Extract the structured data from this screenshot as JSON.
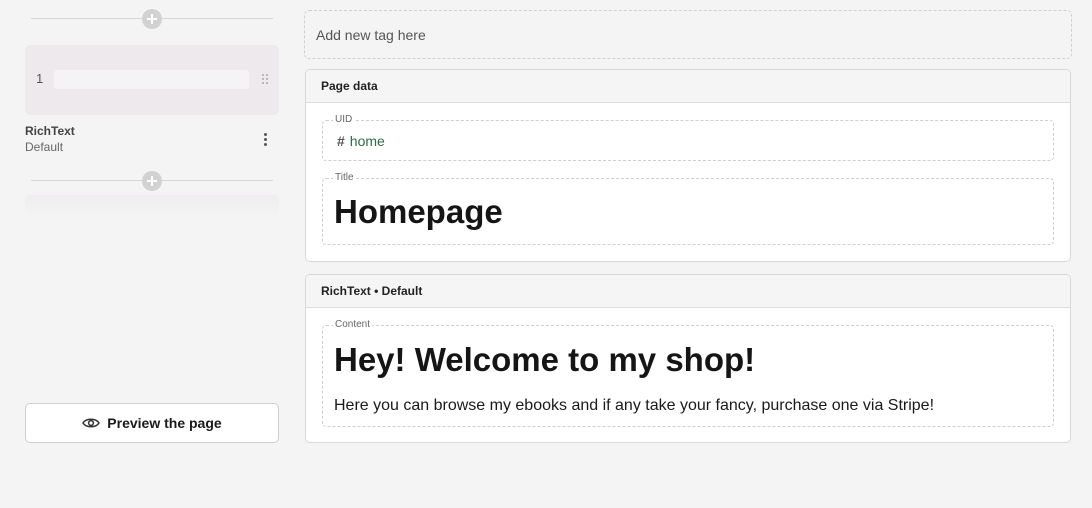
{
  "sidebar": {
    "slice": {
      "index": "1",
      "name": "RichText",
      "variation": "Default"
    },
    "preview_button": {
      "label": "Preview the page",
      "icon": "eye-icon"
    },
    "add_icon": "plus-circle-icon"
  },
  "tags": {
    "placeholder": "Add new tag here"
  },
  "page_data_panel": {
    "title": "Page data",
    "uid": {
      "label": "UID",
      "icon": "hash-icon",
      "value": "home"
    },
    "title_field": {
      "label": "Title",
      "value": "Homepage"
    }
  },
  "richtext_panel": {
    "title": "RichText • Default",
    "content": {
      "label": "Content",
      "heading": "Hey! Welcome to my shop!",
      "paragraph": "Here you can browse my ebooks and if any take your fancy, purchase one via Stripe!"
    }
  },
  "colors": {
    "background": "#f4f4f4",
    "uid_text": "#2e6b4b",
    "slice_card": "#ede9ed"
  }
}
